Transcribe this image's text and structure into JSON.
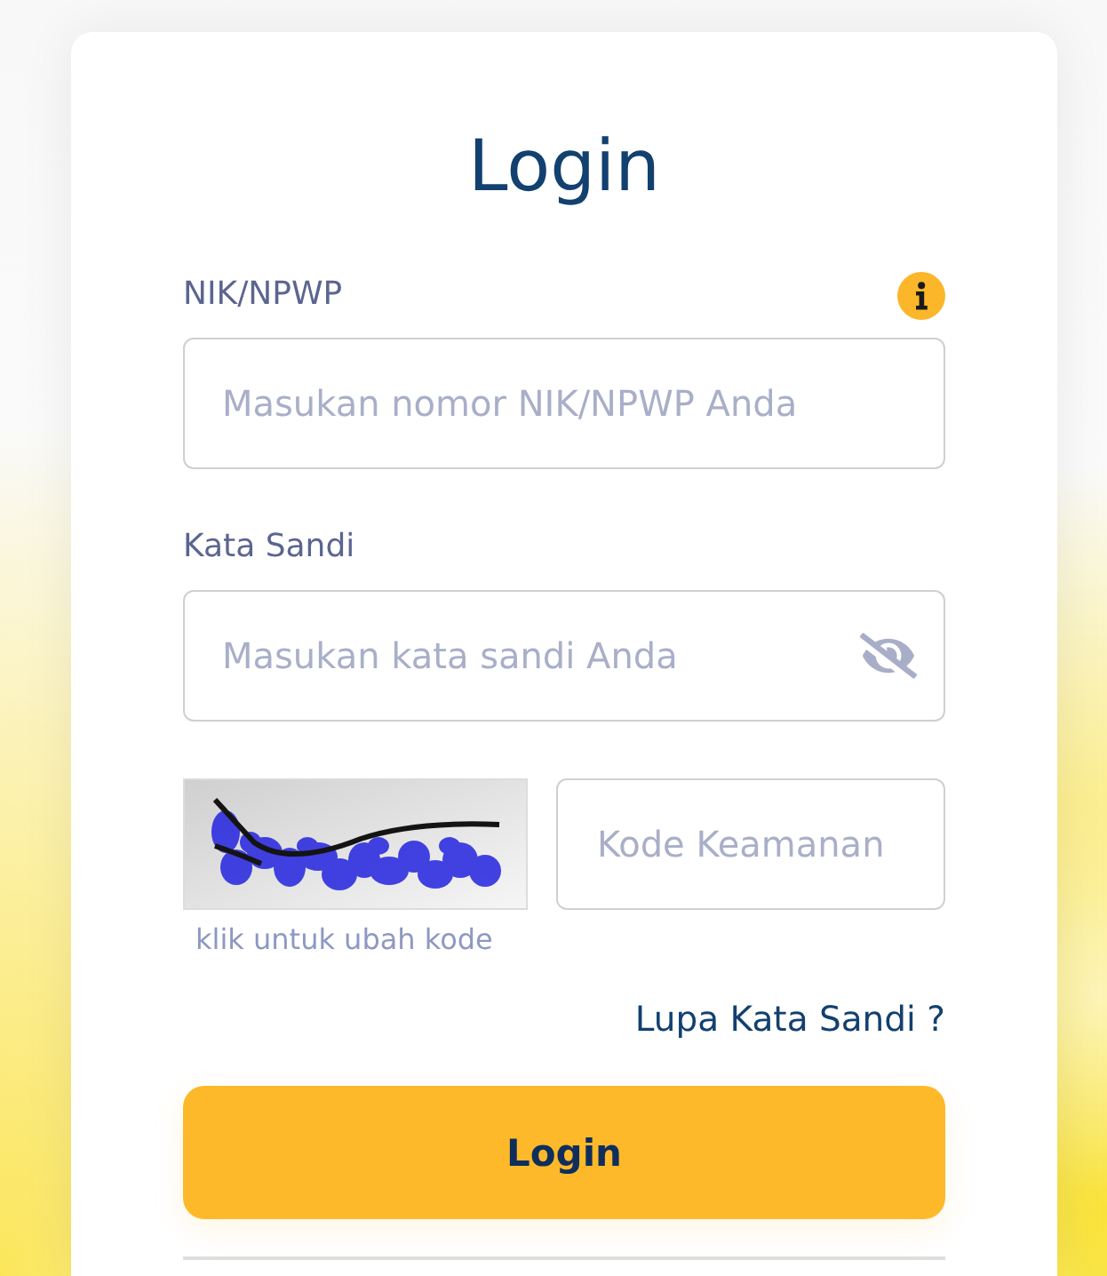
{
  "title": "Login",
  "nik_field": {
    "label": "NIK/NPWP",
    "placeholder": "Masukan nomor NIK/NPWP Anda"
  },
  "password_field": {
    "label": "Kata Sandi",
    "placeholder": "Masukan kata sandi Anda",
    "visible": false
  },
  "captcha": {
    "hint": "klik untuk ubah kode",
    "placeholder": "Kode Keamanan"
  },
  "forgot_link": "Lupa Kata Sandi ?",
  "submit": "Login"
}
